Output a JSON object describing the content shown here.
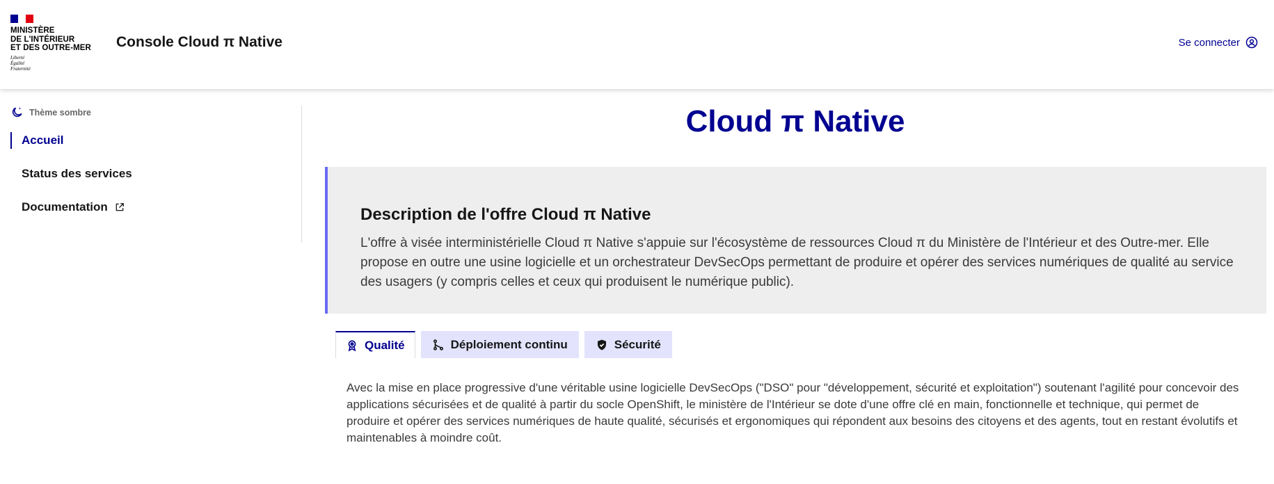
{
  "header": {
    "ministry": "Ministère\nde l'Intérieur\net des Outre-mer",
    "devise": "Liberté\nÉgalité\nFraternité",
    "service_title": "Console Cloud π Native",
    "login_label": "Se connecter",
    "login_icon": "user-circle-icon"
  },
  "sidebar": {
    "theme_toggle_label": "Thème sombre",
    "theme_icon": "moon-icon",
    "items": [
      {
        "label": "Accueil",
        "active": true
      },
      {
        "label": "Status des services",
        "active": false
      },
      {
        "label": "Documentation",
        "active": false,
        "icon": "external-link-icon"
      }
    ]
  },
  "main": {
    "title": "Cloud π Native",
    "callout": {
      "title": "Description de l'offre Cloud π Native",
      "text": "L'offre à visée interministérielle Cloud π Native s'appuie sur l'écosystème de ressources Cloud π du Ministère de l'Intérieur et des Outre-mer. Elle propose en outre une usine logicielle et un orchestrateur DevSecOps permettant de produire et opérer des services numériques de qualité au service des usagers (y compris celles et ceux qui produisent le numérique public)."
    },
    "tabs": [
      {
        "label": "Qualité",
        "icon": "award-icon",
        "active": true
      },
      {
        "label": "Déploiement continu",
        "icon": "git-branch-icon",
        "active": false
      },
      {
        "label": "Sécurité",
        "icon": "shield-icon",
        "active": false
      }
    ],
    "tab_panel_text": "Avec la mise en place progressive d'une véritable usine logicielle DevSecOps (\"DSO\" pour \"développement, sécurité et exploitation\") soutenant l'agilité pour concevoir des applications sécurisées et de qualité à partir du socle OpenShift, le ministère de l'Intérieur se dote d'une offre clé en main, fonctionnelle et technique, qui permet de produire et opérer des services numériques de haute qualité, sécurisés et ergonomiques qui répondent aux besoins des citoyens et des agents, tout en restant évolutifs et maintenables à moindre coût."
  },
  "colors": {
    "primary": "#000091",
    "accent": "#6a6af4",
    "callout_bg": "#eeeeee",
    "tab_bg": "#e3e3fd"
  }
}
